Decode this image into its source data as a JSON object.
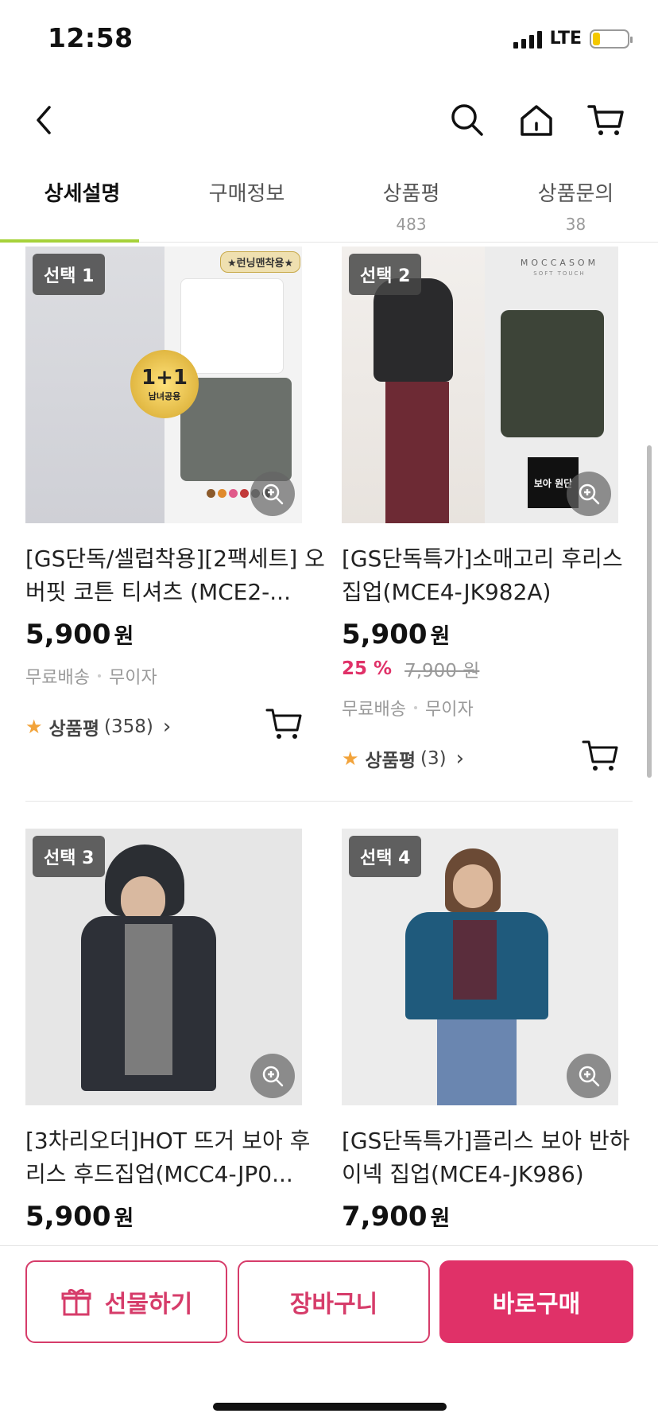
{
  "status": {
    "time": "12:58",
    "network": "LTE"
  },
  "tabs": [
    {
      "label": "상세설명",
      "count": ""
    },
    {
      "label": "구매정보",
      "count": ""
    },
    {
      "label": "상품평",
      "count": "483"
    },
    {
      "label": "상품문의",
      "count": "38"
    }
  ],
  "products": [
    {
      "badge": "선택 1",
      "title": "[GS단독/셀럽착용][2팩세트] 오버핏 코튼 티셔츠 (MCE2-...",
      "price": "5,900",
      "currency": "원",
      "discount_pct": "",
      "orig_price": "",
      "shipping": "무료배송",
      "installment": "무이자",
      "review_label": "상품평",
      "review_count": "(358)",
      "img_tag": "★런닝맨착용★",
      "img_badge": "1+1",
      "img_badge_sub": "남녀공용"
    },
    {
      "badge": "선택 2",
      "title": "[GS단독특가]소매고리 후리스 집업(MCE4-JK982A)",
      "price": "5,900",
      "currency": "원",
      "discount_pct": "25 %",
      "orig_price": "7,900 원",
      "shipping": "무료배송",
      "installment": "무이자",
      "review_label": "상품평",
      "review_count": "(3)",
      "img_brand": "MOCCASOM",
      "img_brand_sub": "SOFT TOUCH",
      "img_label": "보아 원단"
    },
    {
      "badge": "선택 3",
      "title": "[3차리오더]HOT 뜨거 보아 후리스 후드집업(MCC4-JP0...",
      "price": "5,900",
      "currency": "원"
    },
    {
      "badge": "선택 4",
      "title": "[GS단독특가]플리스 보아 반하이넥 집업(MCE4-JK986)",
      "price": "7,900",
      "currency": "원"
    }
  ],
  "actions": {
    "gift": "선물하기",
    "cart": "장바구니",
    "buy": "바로구매"
  },
  "colors": {
    "accent": "#e03168",
    "tab_underline": "#a6d23a",
    "star": "#f2a33a"
  }
}
